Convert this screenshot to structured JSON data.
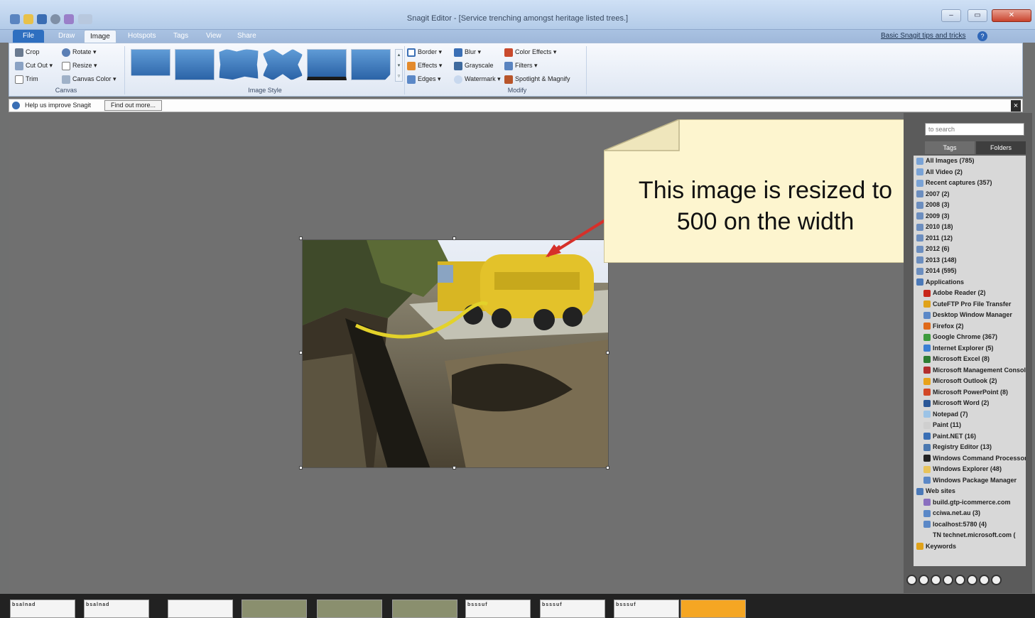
{
  "window": {
    "title": "Snagit Editor - [Service trenching amongst heritage listed trees.]"
  },
  "tabs": [
    "File",
    "Draw",
    "Image",
    "Hotspots",
    "Tags",
    "View",
    "Share"
  ],
  "active_tab": "Image",
  "help_link": "Basic Snagit tips and tricks",
  "ribbon": {
    "canvas": {
      "crop": "Crop",
      "rotate": "Rotate",
      "cut_out": "Cut Out",
      "resize": "Resize",
      "trim": "Trim",
      "canvas_color": "Canvas Color",
      "label": "Canvas"
    },
    "image_style": {
      "label": "Image Style"
    },
    "modify": {
      "border": "Border",
      "effects": "Effects",
      "edges": "Edges",
      "blur": "Blur",
      "grayscale": "Grayscale",
      "watermark": "Watermark",
      "color_effects": "Color Effects",
      "filters": "Filters",
      "spotlight": "Spotlight & Magnify",
      "label": "Modify"
    }
  },
  "notify": {
    "text": "Help us improve Snagit",
    "button": "Find out more..."
  },
  "callout": {
    "text_line1": "This image is resized to",
    "text_line2": "500 on the width"
  },
  "library": {
    "search_placeholder": "to search",
    "tab_tags": "Tags",
    "tab_folders": "Folders",
    "items": [
      {
        "label": "All Images (785)",
        "color": "#7aa3d6"
      },
      {
        "label": "All Video (2)",
        "color": "#7aa3d6"
      },
      {
        "label": "Recent captures (357)",
        "color": "#7aa3d6"
      },
      {
        "label": "2007 (2)",
        "color": "#6c8ebf"
      },
      {
        "label": "2008 (3)",
        "color": "#6c8ebf"
      },
      {
        "label": "2009 (3)",
        "color": "#6c8ebf"
      },
      {
        "label": "2010 (18)",
        "color": "#6c8ebf"
      },
      {
        "label": "2011 (12)",
        "color": "#6c8ebf"
      },
      {
        "label": "2012 (6)",
        "color": "#6c8ebf"
      },
      {
        "label": "2013 (148)",
        "color": "#6c8ebf"
      },
      {
        "label": "2014 (595)",
        "color": "#6c8ebf"
      },
      {
        "label": "Applications",
        "color": "#4b79b8"
      },
      {
        "label": "Adobe Reader (2)",
        "color": "#c8261b"
      },
      {
        "label": "CuteFTP Pro File Transfer",
        "color": "#e0a21a"
      },
      {
        "label": "Desktop Window Manager",
        "color": "#5b88c7"
      },
      {
        "label": "Firefox (2)",
        "color": "#e06a1a"
      },
      {
        "label": "Google Chrome (367)",
        "color": "#3c9a3c"
      },
      {
        "label": "Internet Explorer (5)",
        "color": "#3b7fd4"
      },
      {
        "label": "Microsoft Excel (8)",
        "color": "#2e7d32"
      },
      {
        "label": "Microsoft Management Console",
        "color": "#b32d2d"
      },
      {
        "label": "Microsoft Outlook (2)",
        "color": "#e8a21a"
      },
      {
        "label": "Microsoft PowerPoint (8)",
        "color": "#d24726"
      },
      {
        "label": "Microsoft Word (2)",
        "color": "#2b5797"
      },
      {
        "label": "Notepad (7)",
        "color": "#9cc3e6"
      },
      {
        "label": "Paint (11)",
        "color": "#cfcfcf"
      },
      {
        "label": "Paint.NET (16)",
        "color": "#3a6fb5"
      },
      {
        "label": "Registry Editor (13)",
        "color": "#4a78b0"
      },
      {
        "label": "Windows Command Processor",
        "color": "#222222"
      },
      {
        "label": "Windows Explorer (48)",
        "color": "#e8c35a"
      },
      {
        "label": "Windows Package Manager",
        "color": "#5b88c7"
      },
      {
        "label": "Web sites",
        "color": "#4b79b8"
      },
      {
        "label": "build.gtp-icommerce.com",
        "color": "#8a6fbf"
      },
      {
        "label": "cciwa.net.au (3)",
        "color": "#5b88c7"
      },
      {
        "label": "localhost:5780 (4)",
        "color": "#5b88c7"
      },
      {
        "label": "TN technet.microsoft.com (",
        "color": "#d8d8d8"
      },
      {
        "label": "Keywords",
        "color": "#e0a21a"
      }
    ]
  },
  "tray": {
    "thumbs": [
      {
        "label": "bsalnad",
        "kind": "doc"
      },
      {
        "label": "bsalnad",
        "kind": "doc"
      },
      {
        "label": "",
        "kind": "doc"
      },
      {
        "label": "",
        "kind": "pic"
      },
      {
        "label": "",
        "kind": "pic"
      },
      {
        "label": "",
        "kind": "pic"
      },
      {
        "label": "bsssuf",
        "kind": "doc"
      },
      {
        "label": "bsssuf",
        "kind": "doc"
      },
      {
        "label": "bsssuf",
        "kind": "doc"
      },
      {
        "label": "",
        "kind": "sel"
      }
    ]
  }
}
